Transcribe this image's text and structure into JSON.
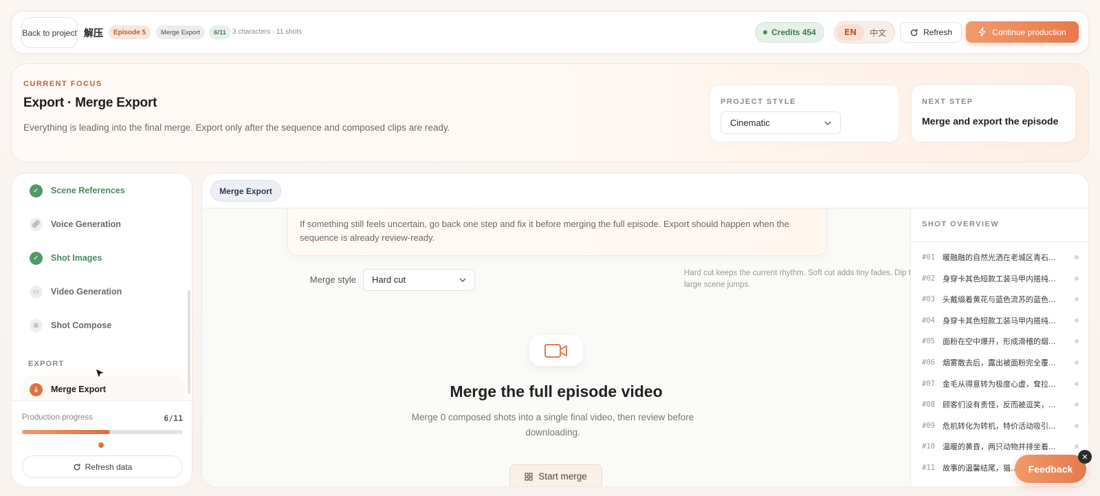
{
  "topbar": {
    "back_label": "Back to project",
    "project_name": "解压",
    "episode": "Episode 5",
    "current_step": "Merge Export",
    "step_count": "6/11",
    "meta": "3 characters · 11 shots",
    "credits": "Credits 454",
    "lang_en": "EN",
    "lang_zh": "中文",
    "refresh_label": "Refresh",
    "continue_label": "Continue production"
  },
  "focus": {
    "eyebrow": "CURRENT FOCUS",
    "title": "Export · Merge Export",
    "description": "Everything is leading into the final merge. Export only after the sequence and composed clips are ready.",
    "style_label": "PROJECT STYLE",
    "style_value": "Cinematic",
    "next_label": "NEXT STEP",
    "next_value": "Merge and export the episode"
  },
  "sidebar": {
    "steps": [
      {
        "label": "Scene References",
        "status": "done"
      },
      {
        "label": "Voice Generation",
        "status": "todo"
      },
      {
        "label": "Shot Images",
        "status": "done"
      },
      {
        "label": "Video Generation",
        "status": "todo"
      },
      {
        "label": "Shot Compose",
        "status": "todo"
      }
    ],
    "section": "EXPORT",
    "active_item": "Merge Export",
    "progress_label": "Production progress",
    "progress_count": "6/11",
    "progress_fraction": 0.545,
    "refresh_label": "Refresh data"
  },
  "main": {
    "tab": "Merge Export",
    "hint_text": "If something still feels uncertain, go back one step and fix it before merging the full episode. Export should happen when the sequence is already review-ready.",
    "merge_style_label": "Merge style",
    "merge_style_value": "Hard cut",
    "merge_help": "Hard cut keeps the current rhythm. Soft cut adds tiny fades. Dip to black works better for large scene jumps.",
    "empty_title": "Merge the full episode video",
    "empty_desc": "Merge 0 composed shots into a single final video, then review before downloading.",
    "start_label": "Start merge"
  },
  "overview": {
    "title": "SHOT OVERVIEW",
    "shots": [
      {
        "num": "#01",
        "text": "暖融融的自然光洒在老城区青石..."
      },
      {
        "num": "#02",
        "text": "身穿卡其色短款工装马甲内搭纯..."
      },
      {
        "num": "#03",
        "text": "头戴缀着黄花与蓝色流苏的蓝色..."
      },
      {
        "num": "#04",
        "text": "身穿卡其色短款工装马甲内搭纯..."
      },
      {
        "num": "#05",
        "text": "面粉在空中爆开，形成滑稽的烟..."
      },
      {
        "num": "#06",
        "text": "烟雾散去后，露出被面粉完全覆..."
      },
      {
        "num": "#07",
        "text": "金毛从得意转为极度心虚，耷拉..."
      },
      {
        "num": "#08",
        "text": "顾客们没有责怪，反而被逗笑，..."
      },
      {
        "num": "#09",
        "text": "危机转化为转机，特价活动吸引..."
      },
      {
        "num": "#10",
        "text": "温暖的黄昏，两只动物并排坐着..."
      },
      {
        "num": "#11",
        "text": "故事的温馨结尾，猫..."
      }
    ]
  },
  "feedback_label": "Feedback",
  "colors": {
    "accent": "#e9784a",
    "success": "#4f9a67"
  }
}
